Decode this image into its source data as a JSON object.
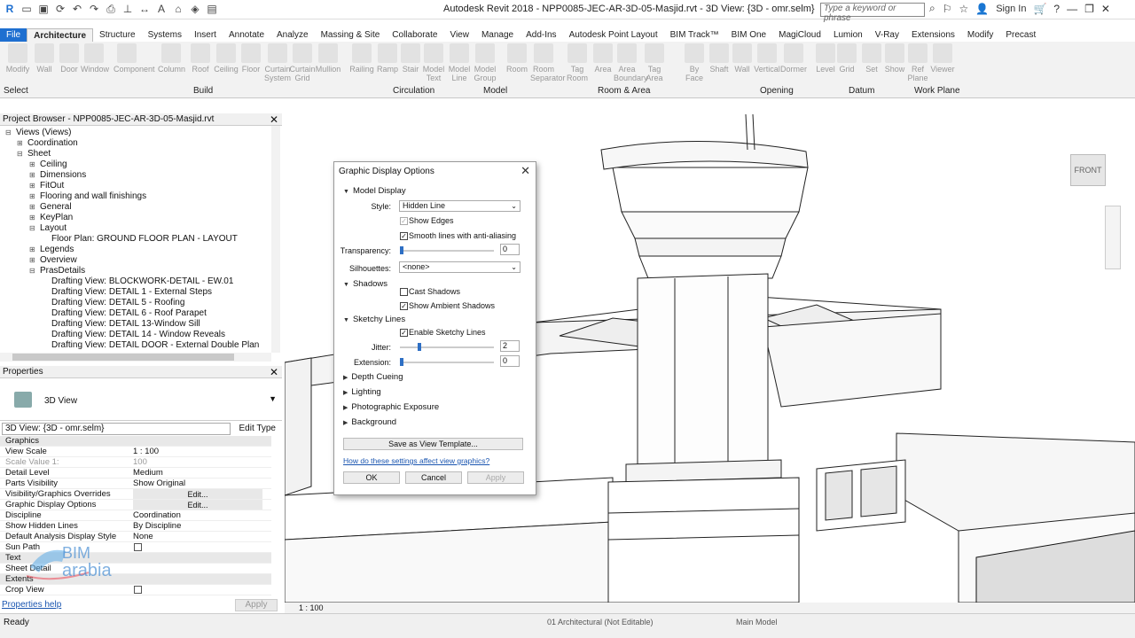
{
  "window": {
    "title": "Autodesk Revit 2018 -    NPP0085-JEC-AR-3D-05-Masjid.rvt - 3D View: {3D - omr.selm}",
    "search_placeholder": "Type a keyword or phrase",
    "sign_in": "Sign In"
  },
  "ribbon": {
    "tabs": [
      "File",
      "Architecture",
      "Structure",
      "Systems",
      "Insert",
      "Annotate",
      "Analyze",
      "Massing & Site",
      "Collaborate",
      "View",
      "Manage",
      "Add-Ins",
      "Autodesk Point Layout",
      "BIM Track™",
      "BIM One",
      "MagiCloud",
      "Lumion",
      "V-Ray",
      "Extensions",
      "Modify",
      "Precast"
    ],
    "active_tab": "Architecture",
    "tools": [
      "Modify",
      "Wall",
      "Door",
      "Window",
      "Component",
      "Column",
      "Roof",
      "Ceiling",
      "Floor",
      "Curtain System",
      "Curtain Grid",
      "Mullion",
      "Railing",
      "Ramp",
      "Stair",
      "Model Text",
      "Model Line",
      "Model Group",
      "Room",
      "Room Separator",
      "Tag Room",
      "Area",
      "Area Boundary",
      "Tag Area",
      "By Face",
      "Shaft",
      "Wall",
      "Vertical",
      "Dormer",
      "Level",
      "Grid",
      "Set",
      "Show",
      "Ref Plane",
      "Viewer"
    ],
    "groups": [
      "Select",
      "Build",
      "Circulation",
      "Model",
      "Room & Area",
      "Opening",
      "Datum",
      "Work Plane"
    ]
  },
  "project_browser": {
    "title": "Project Browser - NPP0085-JEC-AR-3D-05-Masjid.rvt",
    "items": [
      {
        "label": "Views (Views)",
        "level": 0,
        "toggle": "−"
      },
      {
        "label": "Coordination",
        "level": 1,
        "toggle": "+"
      },
      {
        "label": "Sheet",
        "level": 1,
        "toggle": "−"
      },
      {
        "label": "Ceiling",
        "level": 2,
        "toggle": "+"
      },
      {
        "label": "Dimensions",
        "level": 2,
        "toggle": "+"
      },
      {
        "label": "FitOut",
        "level": 2,
        "toggle": "+"
      },
      {
        "label": "Flooring and wall finishings",
        "level": 2,
        "toggle": "+"
      },
      {
        "label": "General",
        "level": 2,
        "toggle": "+"
      },
      {
        "label": "KeyPlan",
        "level": 2,
        "toggle": "+"
      },
      {
        "label": "Layout",
        "level": 2,
        "toggle": "−"
      },
      {
        "label": "Floor Plan: GROUND FLOOR PLAN - LAYOUT",
        "level": 3,
        "toggle": ""
      },
      {
        "label": "Legends",
        "level": 2,
        "toggle": "+"
      },
      {
        "label": "Overview",
        "level": 2,
        "toggle": "+"
      },
      {
        "label": "PrasDetails",
        "level": 2,
        "toggle": "−"
      },
      {
        "label": "Drafting View: BLOCKWORK-DETAIL - EW.01",
        "level": 3,
        "toggle": ""
      },
      {
        "label": "Drafting View: DETAIL 1 - External Steps",
        "level": 3,
        "toggle": ""
      },
      {
        "label": "Drafting View: DETAIL 5 - Roofing",
        "level": 3,
        "toggle": ""
      },
      {
        "label": "Drafting View: DETAIL 6 - Roof Parapet",
        "level": 3,
        "toggle": ""
      },
      {
        "label": "Drafting View: DETAIL 13-Window Sill",
        "level": 3,
        "toggle": ""
      },
      {
        "label": "Drafting View: DETAIL 14 - Window Reveals",
        "level": 3,
        "toggle": ""
      },
      {
        "label": "Drafting View: DETAIL DOOR - External Double Plan",
        "level": 3,
        "toggle": ""
      }
    ]
  },
  "properties": {
    "title": "Properties",
    "type_name": "3D View",
    "selector": "3D View: {3D - omr.selm}",
    "edit_type": "Edit Type",
    "rows": [
      {
        "k": "Graphics",
        "v": "",
        "cat": true
      },
      {
        "k": "View Scale",
        "v": "1 : 100"
      },
      {
        "k": "Scale Value   1:",
        "v": "100",
        "dim": true
      },
      {
        "k": "Detail Level",
        "v": "Medium"
      },
      {
        "k": "Parts Visibility",
        "v": "Show Original"
      },
      {
        "k": "Visibility/Graphics Overrides",
        "v": "Edit...",
        "btn": true
      },
      {
        "k": "Graphic Display Options",
        "v": "Edit...",
        "btn": true
      },
      {
        "k": "Discipline",
        "v": "Coordination"
      },
      {
        "k": "Show Hidden Lines",
        "v": "By Discipline"
      },
      {
        "k": "Default Analysis Display Style",
        "v": "None"
      },
      {
        "k": "Sun Path",
        "v": "",
        "chk": true
      },
      {
        "k": "Text",
        "v": "",
        "cat": true
      },
      {
        "k": "Sheet Detail",
        "v": ""
      },
      {
        "k": "Extents",
        "v": "",
        "cat": true
      },
      {
        "k": "Crop View",
        "v": "",
        "chk": true
      }
    ],
    "help_link": "Properties help",
    "apply": "Apply"
  },
  "watermark": {
    "line1": "BIM",
    "line2": "arabia"
  },
  "viewport": {
    "view_cube_label": "FRONT",
    "scale": "1 : 100"
  },
  "status": {
    "text": "Ready",
    "workset": "01 Architectural (Not Editable)",
    "model": "Main Model"
  },
  "dialog": {
    "title": "Graphic Display Options",
    "model_display": {
      "header": "Model Display",
      "style_label": "Style:",
      "style_value": "Hidden Line",
      "show_edges": "Show Edges",
      "smooth_lines": "Smooth lines with anti-aliasing",
      "transparency_label": "Transparency:",
      "transparency_value": "0",
      "silhouettes_label": "Silhouettes:",
      "silhouettes_value": "<none>"
    },
    "shadows": {
      "header": "Shadows",
      "cast": "Cast Shadows",
      "ambient": "Show Ambient Shadows"
    },
    "sketchy": {
      "header": "Sketchy Lines",
      "enable": "Enable Sketchy Lines",
      "jitter_label": "Jitter:",
      "jitter_value": "2",
      "extension_label": "Extension:",
      "extension_value": "0"
    },
    "sections": [
      "Depth Cueing",
      "Lighting",
      "Photographic Exposure",
      "Background"
    ],
    "save_template": "Save as View Template...",
    "help_link": "How do these settings affect view graphics?",
    "ok": "OK",
    "cancel": "Cancel",
    "apply": "Apply"
  }
}
